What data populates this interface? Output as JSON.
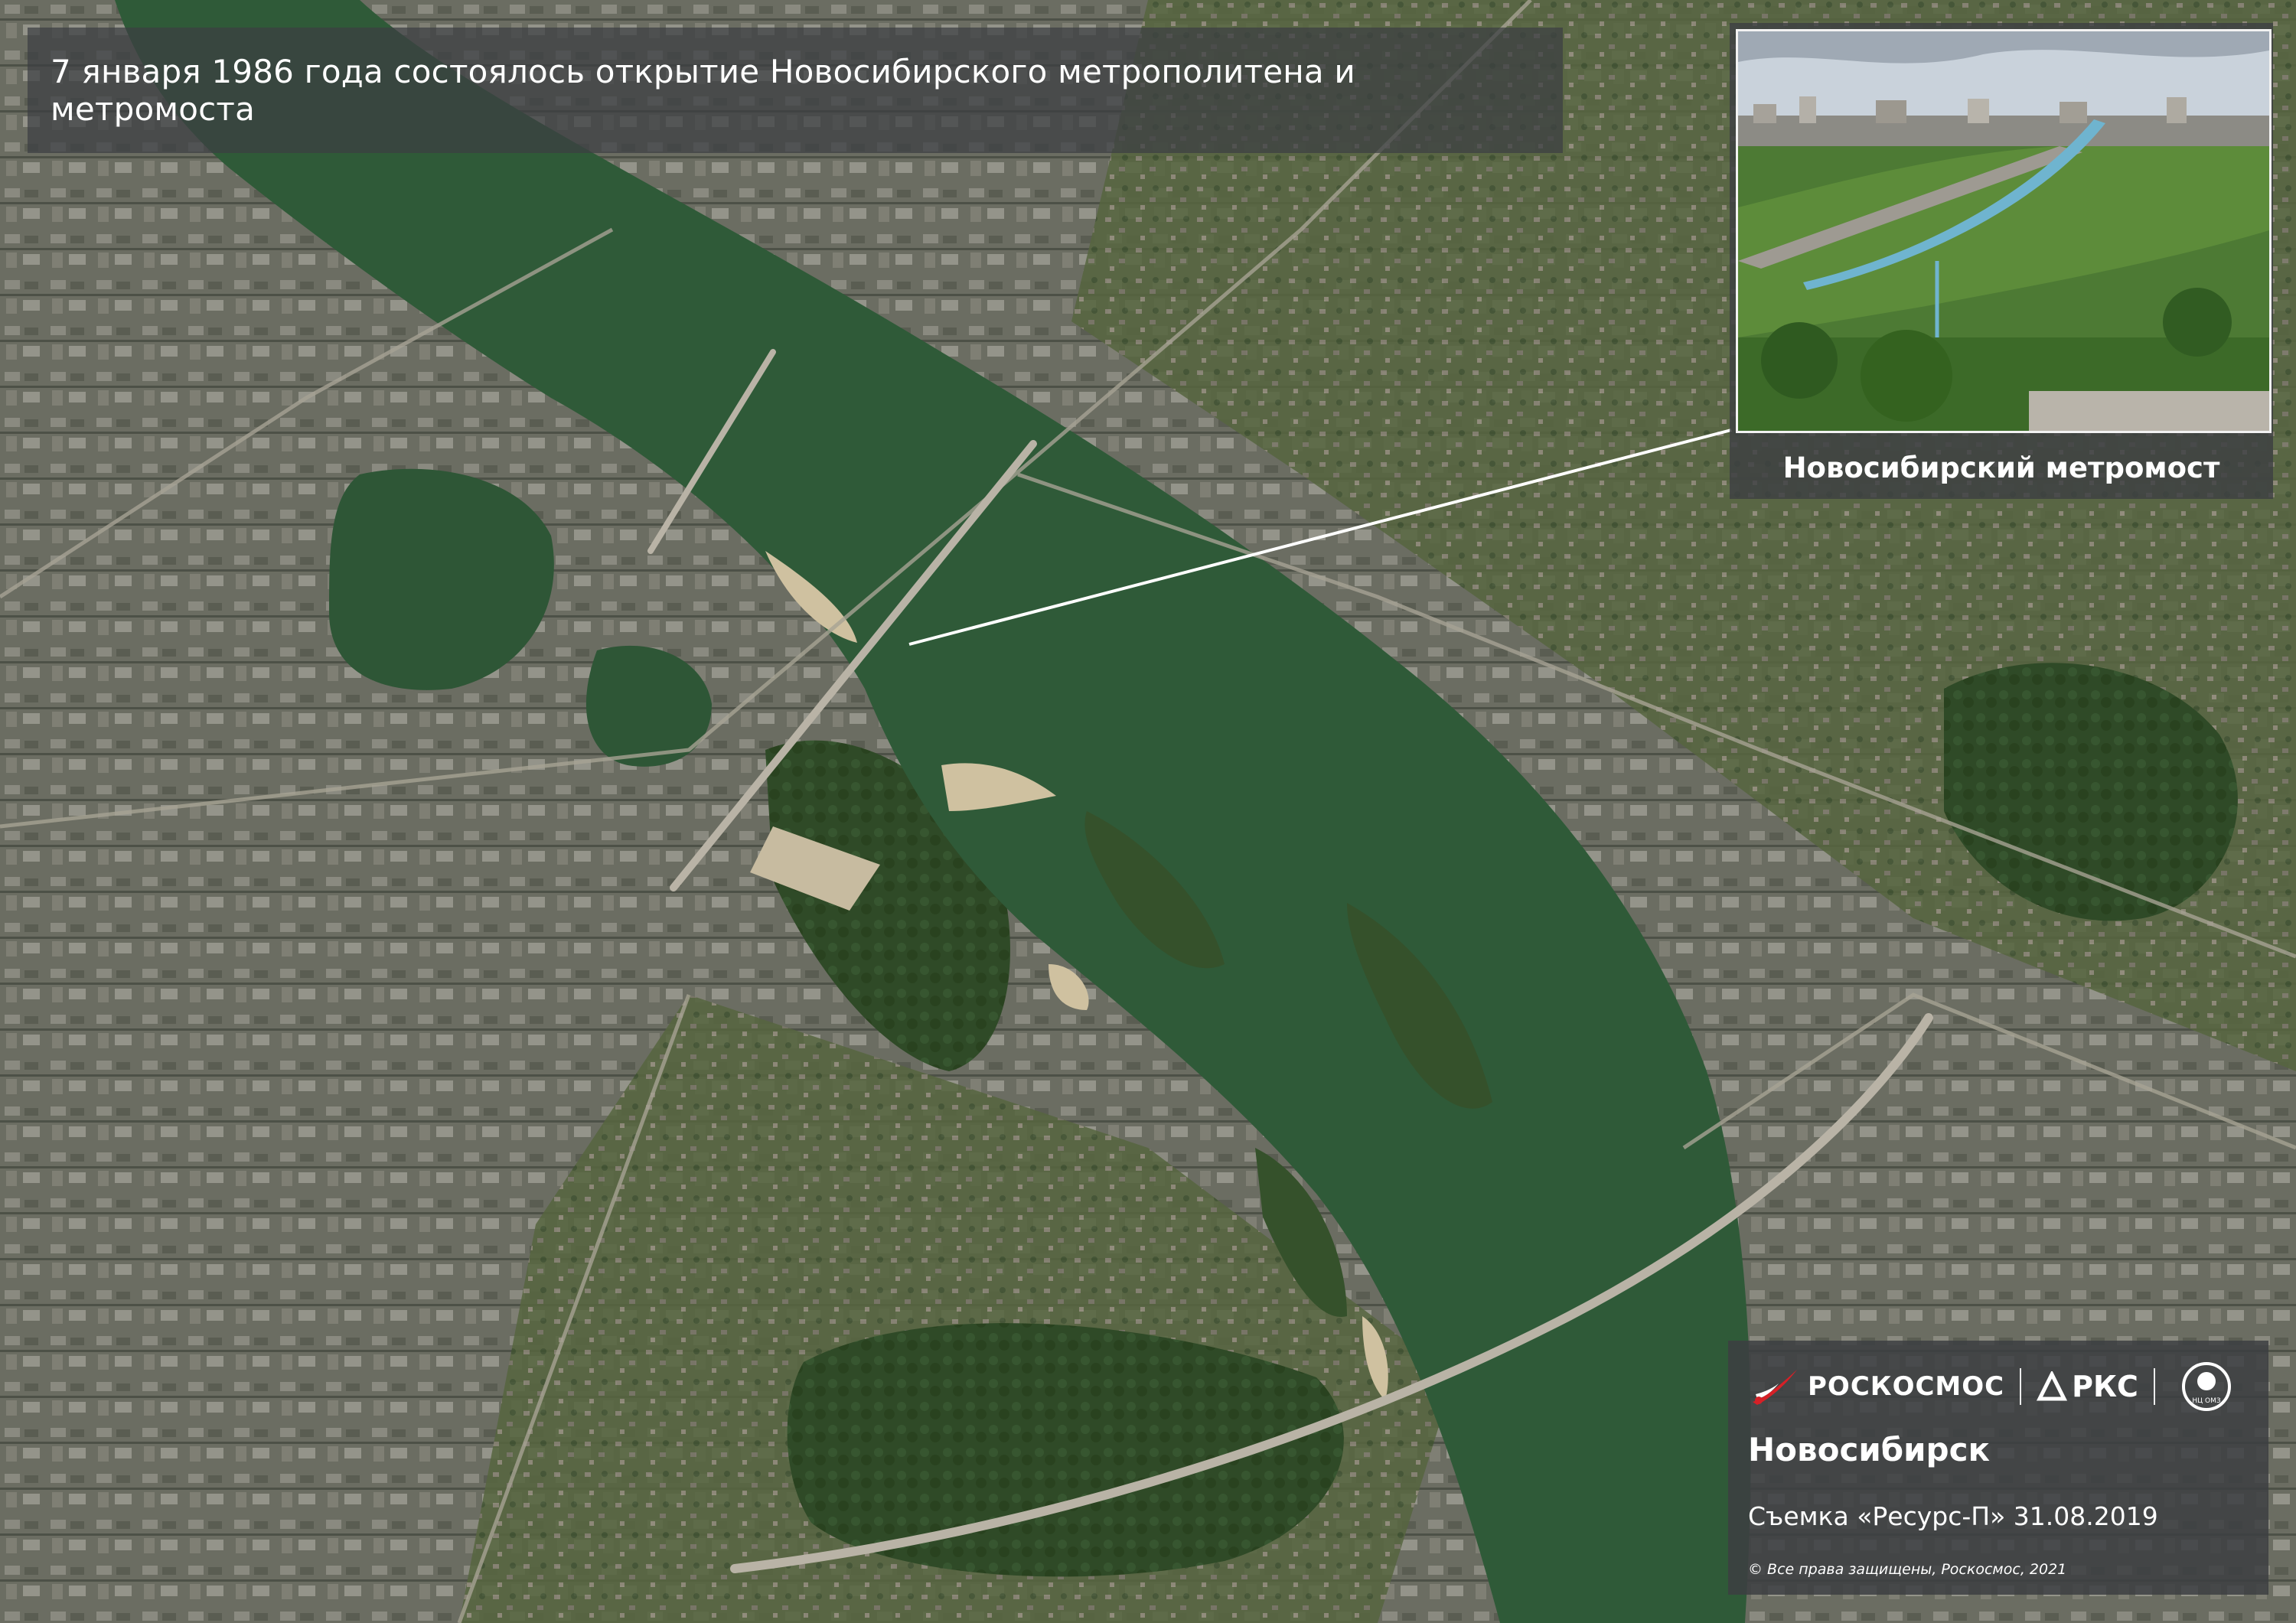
{
  "title": "7 января 1986 года состоялось открытие Новосибирского метрополитена и метромоста",
  "inset": {
    "caption": "Новосибирский метромост"
  },
  "credits": {
    "brand_primary": "РОСКОСМОС",
    "brand_secondary": "РКС",
    "city": "Новосибирск",
    "shoot": "Съемка «Ресурс-П» 31.08.2019",
    "rights": "© Все права защищены, Роскосмос, 2021",
    "seal_text": "НЦ ОМЗ"
  },
  "colors": {
    "river": "#2f5a38",
    "sandbar": "#cfc1a0",
    "forest": "#2e4a26",
    "urban": "#6d6f66",
    "bridge": "#b9b3a6",
    "panel": "#3c3e42",
    "metro_bridge_tube": "#6fb4cf"
  },
  "icons": [
    "rocket-logo-icon",
    "rks-logo-icon",
    "seal-logo-icon"
  ]
}
